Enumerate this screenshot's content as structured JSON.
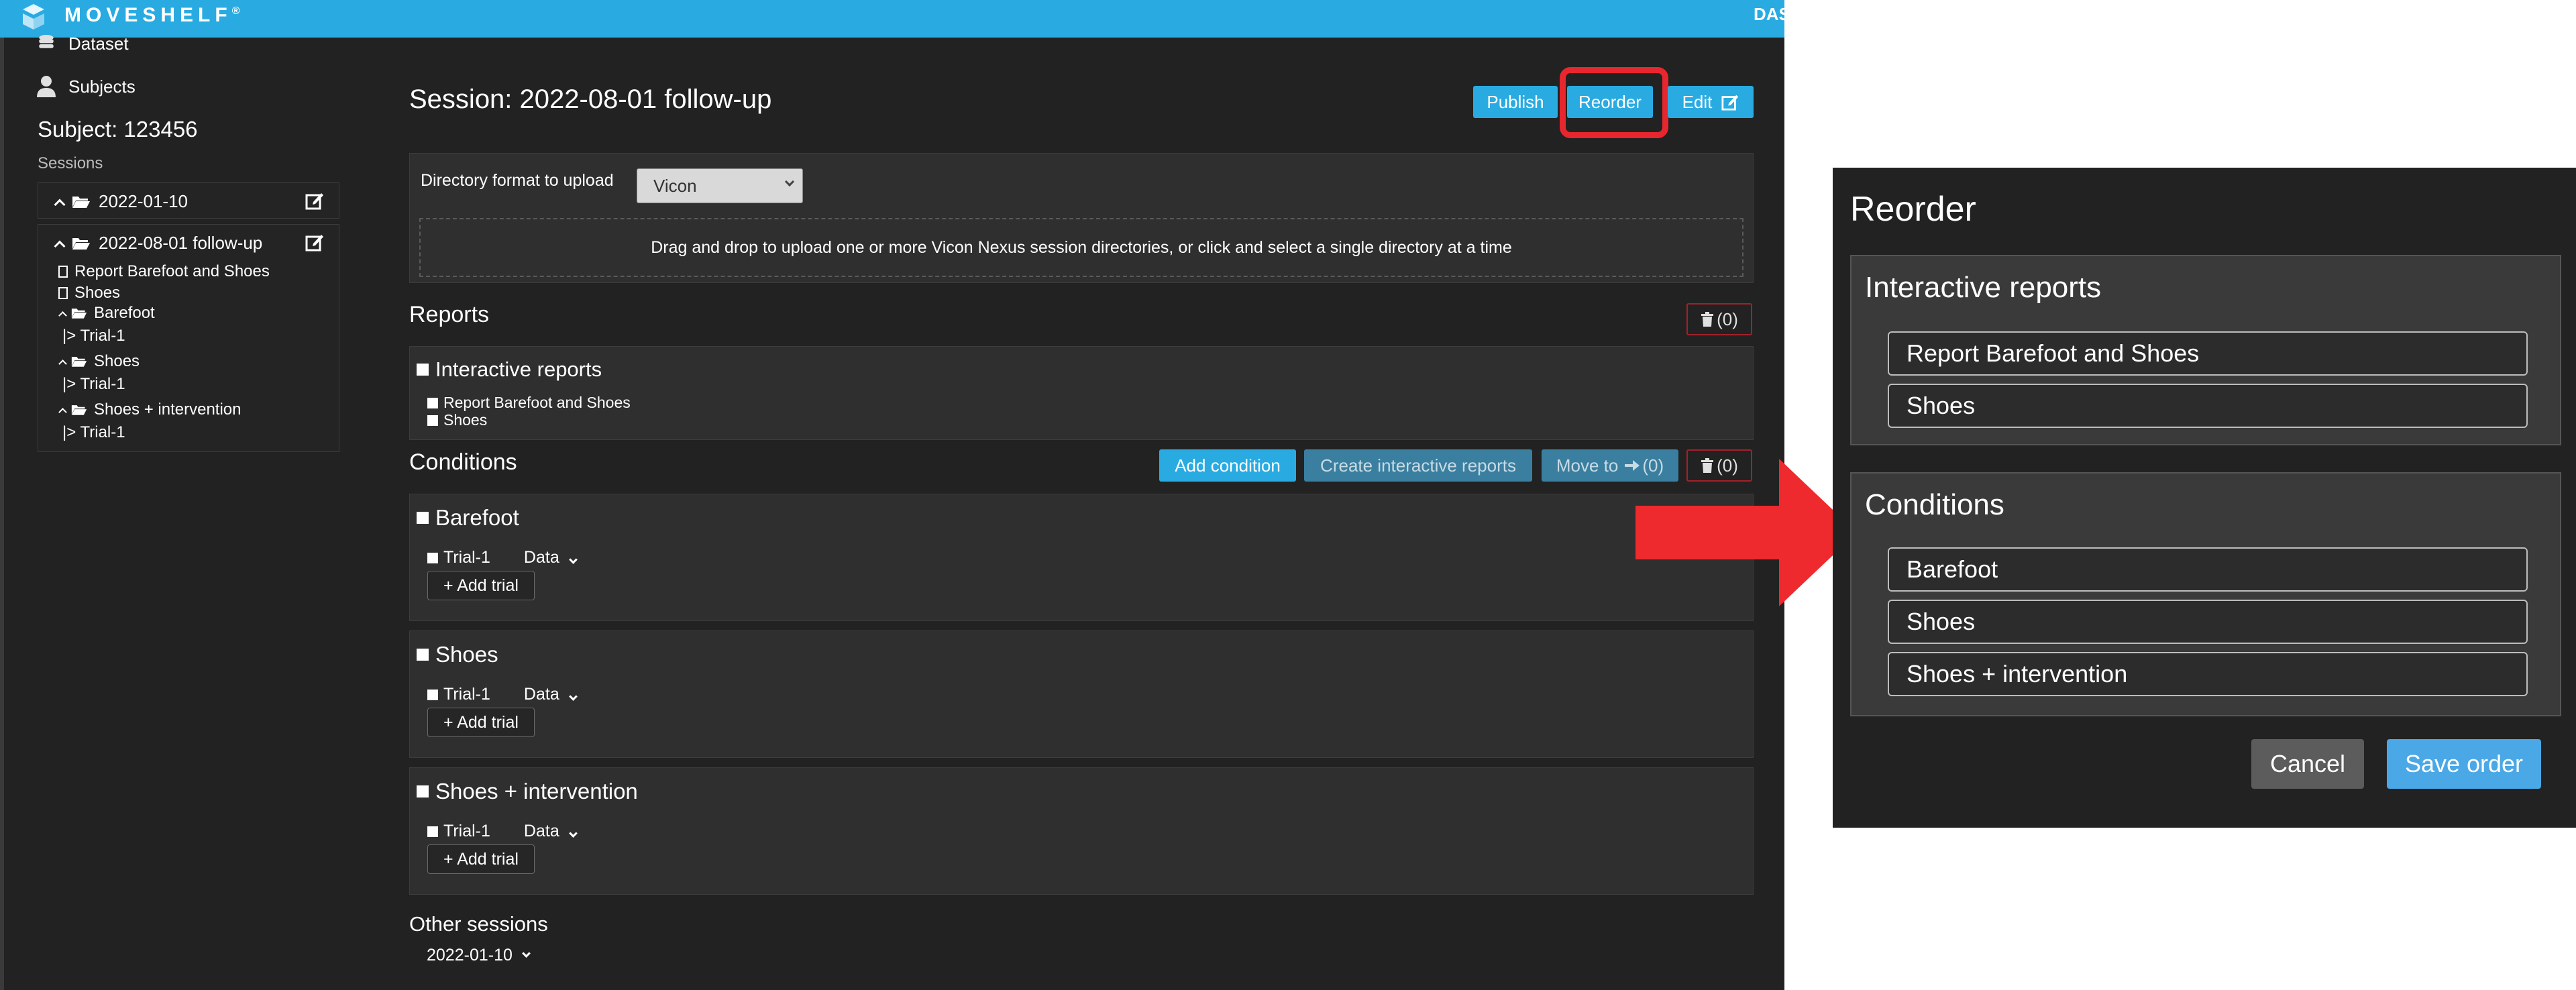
{
  "topbar": {
    "brand": "MOVESHELF",
    "registered": "®",
    "right_text": "DAS"
  },
  "sidebar": {
    "dataset_label": "Dataset",
    "subjects_label": "Subjects",
    "subject_title": "Subject: 123456",
    "sessions_label": "Sessions",
    "session1": {
      "label": "2022-01-10"
    },
    "session2": {
      "label": "2022-08-01 follow-up",
      "reports": [
        "Report Barefoot and Shoes",
        "Shoes"
      ],
      "conditions": [
        {
          "label": "Barefoot",
          "trial": "|> Trial-1"
        },
        {
          "label": "Shoes",
          "trial": "|> Trial-1"
        },
        {
          "label": "Shoes + intervention",
          "trial": "|> Trial-1"
        }
      ]
    }
  },
  "main": {
    "session_title": "Session: 2022-08-01 follow-up",
    "buttons": {
      "publish": "Publish",
      "reorder": "Reorder",
      "edit": "Edit"
    },
    "upload": {
      "format_label": "Directory format to upload",
      "format_value": "Vicon",
      "dropzone": "Drag and drop to upload one or more Vicon Nexus session directories, or click and select a single directory at a time"
    },
    "reports": {
      "heading": "Reports",
      "trash_count": "(0)",
      "group_title": "Interactive reports",
      "items": [
        "Report Barefoot and Shoes",
        "Shoes"
      ]
    },
    "conditions": {
      "heading": "Conditions",
      "add_condition": "Add condition",
      "create_reports": "Create interactive reports",
      "move_to": "Move to",
      "move_count": "(0)",
      "trash_count": "(0)",
      "items": [
        {
          "title": "Barefoot",
          "trial": "Trial-1",
          "data": "Data",
          "add_trial": "+ Add trial"
        },
        {
          "title": "Shoes",
          "trial": "Trial-1",
          "data": "Data",
          "add_trial": "+ Add trial"
        },
        {
          "title": "Shoes + intervention",
          "trial": "Trial-1",
          "data": "Data",
          "add_trial": "+ Add trial"
        }
      ]
    },
    "other_sessions": {
      "heading": "Other sessions",
      "value": "2022-01-10"
    }
  },
  "dialog": {
    "title": "Reorder",
    "reports_group": {
      "title": "Interactive reports",
      "items": [
        "Report Barefoot and Shoes",
        "Shoes"
      ]
    },
    "conditions_group": {
      "title": "Conditions",
      "items": [
        "Barefoot",
        "Shoes",
        "Shoes + intervention"
      ]
    },
    "cancel": "Cancel",
    "save": "Save order"
  },
  "colors": {
    "accent": "#29abe2",
    "highlight": "#e8262e",
    "cancel_bg": "#5c5c5c",
    "save_bg": "#4aa8e6"
  }
}
